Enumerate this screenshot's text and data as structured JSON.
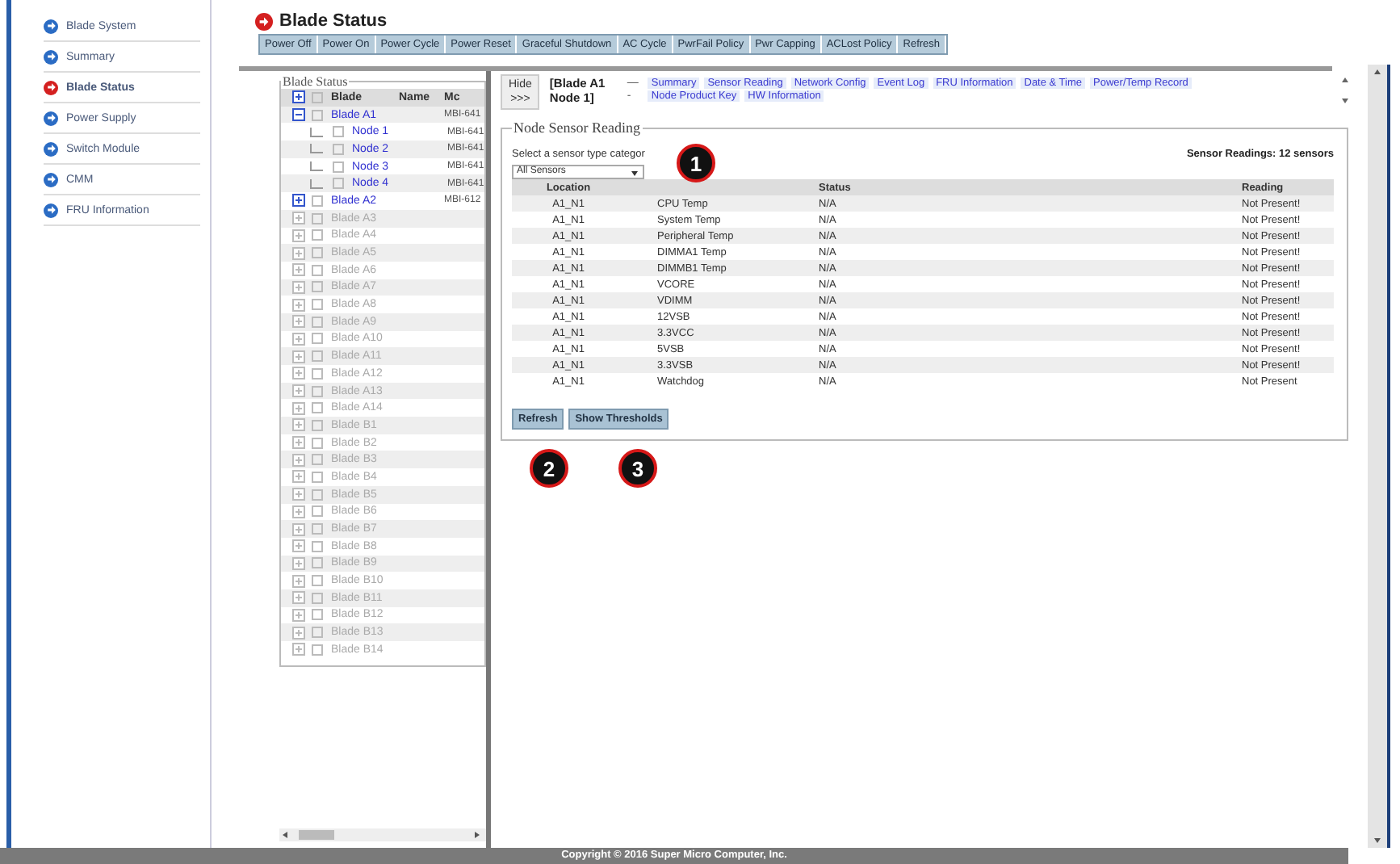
{
  "sidebar": {
    "items": [
      {
        "label": "Blade System",
        "selected": false
      },
      {
        "label": "Summary",
        "selected": false
      },
      {
        "label": "Blade Status",
        "selected": true
      },
      {
        "label": "Power Supply",
        "selected": false
      },
      {
        "label": "Switch Module",
        "selected": false
      },
      {
        "label": "CMM",
        "selected": false
      },
      {
        "label": "FRU Information",
        "selected": false
      }
    ]
  },
  "page_title": "Blade Status",
  "toolbar": [
    "Power Off",
    "Power On",
    "Power Cycle",
    "Power Reset",
    "Graceful Shutdown",
    "AC Cycle",
    "PwrFail Policy",
    "Pwr Capping",
    "ACLost Policy",
    "Refresh"
  ],
  "blade_tree": {
    "legend": "Blade Status",
    "all_checked": false,
    "columns": [
      "Blade",
      "Name",
      "Mc"
    ],
    "rows": [
      {
        "label": "Blade A1",
        "model": "MBI-641",
        "expanded": true,
        "disabled": false,
        "checked": false,
        "children": [
          {
            "label": "Node 1",
            "model": "MBI-641",
            "disabled": false,
            "checked": false
          },
          {
            "label": "Node 2",
            "model": "MBI-641",
            "disabled": false,
            "checked": false
          },
          {
            "label": "Node 3",
            "model": "MBI-641",
            "disabled": false,
            "checked": false
          },
          {
            "label": "Node 4",
            "model": "MBI-641",
            "disabled": false,
            "checked": false
          }
        ]
      },
      {
        "label": "Blade A2",
        "model": "MBI-612",
        "expanded": false,
        "disabled": false,
        "checked": false
      },
      {
        "label": "Blade A3",
        "expanded": false,
        "disabled": true,
        "checked": false
      },
      {
        "label": "Blade A4",
        "expanded": false,
        "disabled": true,
        "checked": false
      },
      {
        "label": "Blade A5",
        "expanded": false,
        "disabled": true,
        "checked": false
      },
      {
        "label": "Blade A6",
        "expanded": false,
        "disabled": true,
        "checked": false
      },
      {
        "label": "Blade A7",
        "expanded": false,
        "disabled": true,
        "checked": false
      },
      {
        "label": "Blade A8",
        "expanded": false,
        "disabled": true,
        "checked": false
      },
      {
        "label": "Blade A9",
        "expanded": false,
        "disabled": true,
        "checked": false
      },
      {
        "label": "Blade A10",
        "expanded": false,
        "disabled": true,
        "checked": false
      },
      {
        "label": "Blade A11",
        "expanded": false,
        "disabled": true,
        "checked": false
      },
      {
        "label": "Blade A12",
        "expanded": false,
        "disabled": true,
        "checked": false
      },
      {
        "label": "Blade A13",
        "expanded": false,
        "disabled": true,
        "checked": false
      },
      {
        "label": "Blade A14",
        "expanded": false,
        "disabled": true,
        "checked": false
      },
      {
        "label": "Blade B1",
        "expanded": false,
        "disabled": true,
        "checked": false
      },
      {
        "label": "Blade B2",
        "expanded": false,
        "disabled": true,
        "checked": false
      },
      {
        "label": "Blade B3",
        "expanded": false,
        "disabled": true,
        "checked": false
      },
      {
        "label": "Blade B4",
        "expanded": false,
        "disabled": true,
        "checked": false
      },
      {
        "label": "Blade B5",
        "expanded": false,
        "disabled": true,
        "checked": false
      },
      {
        "label": "Blade B6",
        "expanded": false,
        "disabled": true,
        "checked": false
      },
      {
        "label": "Blade B7",
        "expanded": false,
        "disabled": true,
        "checked": false
      },
      {
        "label": "Blade B8",
        "expanded": false,
        "disabled": true,
        "checked": false
      },
      {
        "label": "Blade B9",
        "expanded": false,
        "disabled": true,
        "checked": false
      },
      {
        "label": "Blade B10",
        "expanded": false,
        "disabled": true,
        "checked": false
      },
      {
        "label": "Blade B11",
        "expanded": false,
        "disabled": true,
        "checked": false
      },
      {
        "label": "Blade B12",
        "expanded": false,
        "disabled": true,
        "checked": false
      },
      {
        "label": "Blade B13",
        "expanded": false,
        "disabled": true,
        "checked": false
      },
      {
        "label": "Blade B14",
        "expanded": false,
        "disabled": true,
        "checked": false
      }
    ]
  },
  "node_header": {
    "hide_button": {
      "label": "Hide",
      "arrow": ">>>"
    },
    "node_label": "[Blade A1 Node 1]",
    "link_rows": [
      {
        "marker": "—",
        "links": [
          "Summary",
          "Sensor Reading",
          "Network Config",
          "Event Log",
          "FRU Information",
          "Date & Time",
          "Power/Temp Record"
        ]
      },
      {
        "marker": "-",
        "links": [
          "Node Product Key",
          "HW Information"
        ]
      }
    ]
  },
  "sensor_panel": {
    "legend": "Node Sensor Reading",
    "category_label": "Select a sensor type categor",
    "category_select": "All Sensors",
    "summary": "Sensor Readings: 12 sensors",
    "columns": {
      "location": "Location",
      "status": "Status",
      "reading": "Reading"
    },
    "rows": [
      {
        "location": "A1_N1",
        "name": "CPU Temp",
        "status": "N/A",
        "reading": "Not Present!"
      },
      {
        "location": "A1_N1",
        "name": "System Temp",
        "status": "N/A",
        "reading": "Not Present!"
      },
      {
        "location": "A1_N1",
        "name": "Peripheral Temp",
        "status": "N/A",
        "reading": "Not Present!"
      },
      {
        "location": "A1_N1",
        "name": "DIMMA1 Temp",
        "status": "N/A",
        "reading": "Not Present!"
      },
      {
        "location": "A1_N1",
        "name": "DIMMB1 Temp",
        "status": "N/A",
        "reading": "Not Present!"
      },
      {
        "location": "A1_N1",
        "name": "VCORE",
        "status": "N/A",
        "reading": "Not Present!"
      },
      {
        "location": "A1_N1",
        "name": "VDIMM",
        "status": "N/A",
        "reading": "Not Present!"
      },
      {
        "location": "A1_N1",
        "name": "12VSB",
        "status": "N/A",
        "reading": "Not Present!"
      },
      {
        "location": "A1_N1",
        "name": "3.3VCC",
        "status": "N/A",
        "reading": "Not Present!"
      },
      {
        "location": "A1_N1",
        "name": "5VSB",
        "status": "N/A",
        "reading": "Not Present!"
      },
      {
        "location": "A1_N1",
        "name": "3.3VSB",
        "status": "N/A",
        "reading": "Not Present!"
      },
      {
        "location": "A1_N1",
        "name": "Watchdog",
        "status": "N/A",
        "reading": "Not Present"
      }
    ],
    "buttons": [
      "Refresh",
      "Show Thresholds"
    ]
  },
  "callouts": [
    "1",
    "2",
    "3"
  ],
  "footer": "Copyright © 2016 Super Micro Computer, Inc."
}
